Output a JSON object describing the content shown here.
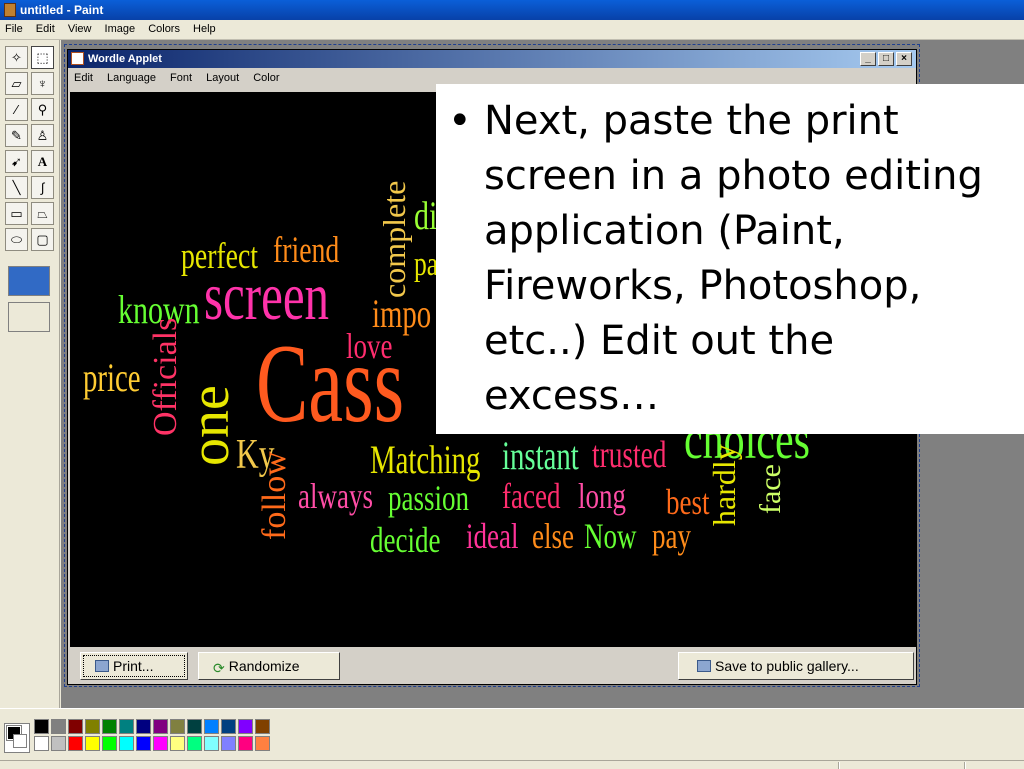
{
  "window": {
    "title": "untitled - Paint"
  },
  "menu": [
    "File",
    "Edit",
    "View",
    "Image",
    "Colors",
    "Help"
  ],
  "tools": [
    "free-form-select-icon",
    "select-icon",
    "eraser-icon",
    "fill-icon",
    "pick-color-icon",
    "magnifier-icon",
    "pencil-icon",
    "brush-icon",
    "airbrush-icon",
    "text-icon",
    "line-icon",
    "curve-icon",
    "rectangle-icon",
    "polygon-icon",
    "ellipse-icon",
    "rounded-rectangle-icon"
  ],
  "applet": {
    "title": "Wordle Applet",
    "menu": [
      "Edit",
      "Language",
      "Font",
      "Layout",
      "Color"
    ],
    "buttons": {
      "print": "Print...",
      "randomize": "Randomize",
      "save": "Save to public gallery..."
    }
  },
  "words": [
    {
      "text": "perfect",
      "color": "#e6e600"
    },
    {
      "text": "friend",
      "color": "#ff8c1a"
    },
    {
      "text": "complete",
      "color": "#f2c84b"
    },
    {
      "text": "di",
      "color": "#99ff33"
    },
    {
      "text": "pa",
      "color": "#e6e600"
    },
    {
      "text": "known",
      "color": "#66ff33"
    },
    {
      "text": "screen",
      "color": "#ff33aa"
    },
    {
      "text": "impo",
      "color": "#ff8c1a"
    },
    {
      "text": "love",
      "color": "#ff2d6e"
    },
    {
      "text": "price",
      "color": "#ffcc33"
    },
    {
      "text": "Officials",
      "color": "#ff3366"
    },
    {
      "text": "one",
      "color": "#e6e600"
    },
    {
      "text": "Cass",
      "color": "#ff5a1f"
    },
    {
      "text": "Ky",
      "color": "#f2c84b"
    },
    {
      "text": "follow",
      "color": "#ff6a1a"
    },
    {
      "text": "always",
      "color": "#ff4da6"
    },
    {
      "text": "Matching",
      "color": "#e6e600"
    },
    {
      "text": "passion",
      "color": "#66ff33"
    },
    {
      "text": "decide",
      "color": "#66ff33"
    },
    {
      "text": "instant",
      "color": "#66ff99"
    },
    {
      "text": "trusted",
      "color": "#ff2d6e"
    },
    {
      "text": "choices",
      "color": "#66ff33"
    },
    {
      "text": "faced",
      "color": "#ff2d6e"
    },
    {
      "text": "long",
      "color": "#ff4da6"
    },
    {
      "text": "ideal",
      "color": "#ff3399"
    },
    {
      "text": "else",
      "color": "#ff8c1a"
    },
    {
      "text": "Now",
      "color": "#66ff33"
    },
    {
      "text": "best",
      "color": "#ff6a1a"
    },
    {
      "text": "pay",
      "color": "#ff8c1a"
    },
    {
      "text": "hardly",
      "color": "#e6e600"
    },
    {
      "text": "face",
      "color": "#ccff66"
    }
  ],
  "overlay": {
    "bullet": "•",
    "text": "Next, paste the print screen in a photo editing application (Paint, Fireworks, Photoshop, etc..)  Edit out the excess…"
  },
  "palette": {
    "foreground": "#000000",
    "background": "#ffffff",
    "top_row": [
      "#000000",
      "#808080",
      "#800000",
      "#808000",
      "#008000",
      "#008080",
      "#000080",
      "#800080",
      "#808040",
      "#004040",
      "#0080ff",
      "#004080",
      "#8000ff",
      "#804000"
    ],
    "bottom_row": [
      "#ffffff",
      "#c0c0c0",
      "#ff0000",
      "#ffff00",
      "#00ff00",
      "#00ffff",
      "#0000ff",
      "#ff00ff",
      "#ffff80",
      "#00ff80",
      "#80ffff",
      "#8080ff",
      "#ff0080",
      "#ff8040"
    ]
  }
}
